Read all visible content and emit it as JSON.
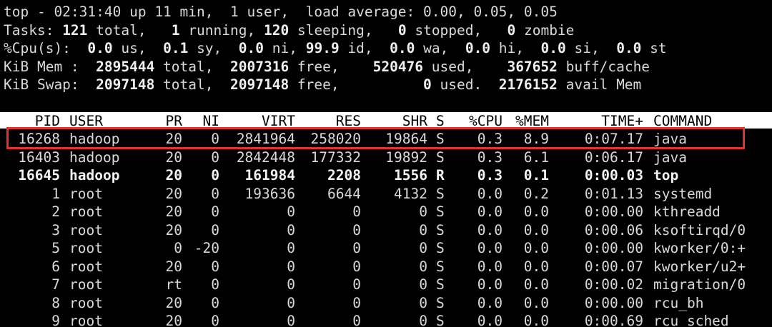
{
  "summary": {
    "line1": "top - 02:31:40 up 11 min,  1 user,  load average: 0.00, 0.05, 0.05",
    "tasks": {
      "prefix": "Tasks: ",
      "total": "121",
      "total_label": " total,   ",
      "running": "1",
      "running_label": " running, ",
      "sleeping": "120",
      "sleeping_label": " sleeping,   ",
      "stopped": "0",
      "stopped_label": " stopped,   ",
      "zombie": "0",
      "zombie_label": " zombie"
    },
    "cpu": {
      "prefix": "%Cpu(s):  ",
      "us": "0.0",
      "us_label": " us,  ",
      "sy": "0.1",
      "sy_label": " sy,  ",
      "ni": "0.0",
      "ni_label": " ni, ",
      "id": "99.9",
      "id_label": " id,  ",
      "wa": "0.0",
      "wa_label": " wa,  ",
      "hi": "0.0",
      "hi_label": " hi,  ",
      "si": "0.0",
      "si_label": " si,  ",
      "st": "0.0",
      "st_label": " st"
    },
    "mem": {
      "prefix": "KiB Mem :  ",
      "total": "2895444",
      "total_label": " total,  ",
      "free": "2007316",
      "free_label": " free,    ",
      "used": "520476",
      "used_label": " used,    ",
      "buff": "367652",
      "buff_label": " buff/cache"
    },
    "swap": {
      "prefix": "KiB Swap:  ",
      "total": "2097148",
      "total_label": " total,  ",
      "free": "2097148",
      "free_label": " free,          ",
      "used": "0",
      "used_label": " used.  ",
      "avail": "2176152",
      "avail_label": " avail Mem"
    }
  },
  "columns": [
    "PID",
    "USER",
    "PR",
    "NI",
    "VIRT",
    "RES",
    "SHR",
    "S",
    "%CPU",
    "%MEM",
    "TIME+",
    "COMMAND"
  ],
  "processes": [
    {
      "pid": "16268",
      "user": "hadoop",
      "pr": "20",
      "ni": "0",
      "virt": "2841964",
      "res": "258020",
      "shr": "19864",
      "s": "S",
      "cpu": "0.3",
      "mem": "8.9",
      "time": "0:07.17",
      "command": "java"
    },
    {
      "pid": "16403",
      "user": "hadoop",
      "pr": "20",
      "ni": "0",
      "virt": "2842448",
      "res": "177332",
      "shr": "19892",
      "s": "S",
      "cpu": "0.3",
      "mem": "6.1",
      "time": "0:06.17",
      "command": "java"
    },
    {
      "pid": "16645",
      "user": "hadoop",
      "pr": "20",
      "ni": "0",
      "virt": "161984",
      "res": "2208",
      "shr": "1556",
      "s": "R",
      "cpu": "0.3",
      "mem": "0.1",
      "time": "0:00.03",
      "command": "top"
    },
    {
      "pid": "1",
      "user": "root",
      "pr": "20",
      "ni": "0",
      "virt": "193636",
      "res": "6644",
      "shr": "4132",
      "s": "S",
      "cpu": "0.0",
      "mem": "0.2",
      "time": "0:01.13",
      "command": "systemd"
    },
    {
      "pid": "2",
      "user": "root",
      "pr": "20",
      "ni": "0",
      "virt": "0",
      "res": "0",
      "shr": "0",
      "s": "S",
      "cpu": "0.0",
      "mem": "0.0",
      "time": "0:00.00",
      "command": "kthreadd"
    },
    {
      "pid": "3",
      "user": "root",
      "pr": "20",
      "ni": "0",
      "virt": "0",
      "res": "0",
      "shr": "0",
      "s": "S",
      "cpu": "0.0",
      "mem": "0.0",
      "time": "0:00.06",
      "command": "ksoftirqd/0"
    },
    {
      "pid": "5",
      "user": "root",
      "pr": "0",
      "ni": "-20",
      "virt": "0",
      "res": "0",
      "shr": "0",
      "s": "S",
      "cpu": "0.0",
      "mem": "0.0",
      "time": "0:00.00",
      "command": "kworker/0:+"
    },
    {
      "pid": "6",
      "user": "root",
      "pr": "20",
      "ni": "0",
      "virt": "0",
      "res": "0",
      "shr": "0",
      "s": "S",
      "cpu": "0.0",
      "mem": "0.0",
      "time": "0:00.07",
      "command": "kworker/u2+"
    },
    {
      "pid": "7",
      "user": "root",
      "pr": "rt",
      "ni": "0",
      "virt": "0",
      "res": "0",
      "shr": "0",
      "s": "S",
      "cpu": "0.0",
      "mem": "0.0",
      "time": "0:00.02",
      "command": "migration/0"
    },
    {
      "pid": "8",
      "user": "root",
      "pr": "20",
      "ni": "0",
      "virt": "0",
      "res": "0",
      "shr": "0",
      "s": "S",
      "cpu": "0.0",
      "mem": "0.0",
      "time": "0:00.00",
      "command": "rcu_bh"
    },
    {
      "pid": "9",
      "user": "root",
      "pr": "20",
      "ni": "0",
      "virt": "0",
      "res": "0",
      "shr": "0",
      "s": "S",
      "cpu": "0.0",
      "mem": "0.0",
      "time": "0:00.69",
      "command": "rcu_sched"
    }
  ],
  "colors": {
    "background": "#000000",
    "text": "#d9d9d9",
    "header_bar": "#ffffff",
    "highlight_box": "#e6322d"
  }
}
